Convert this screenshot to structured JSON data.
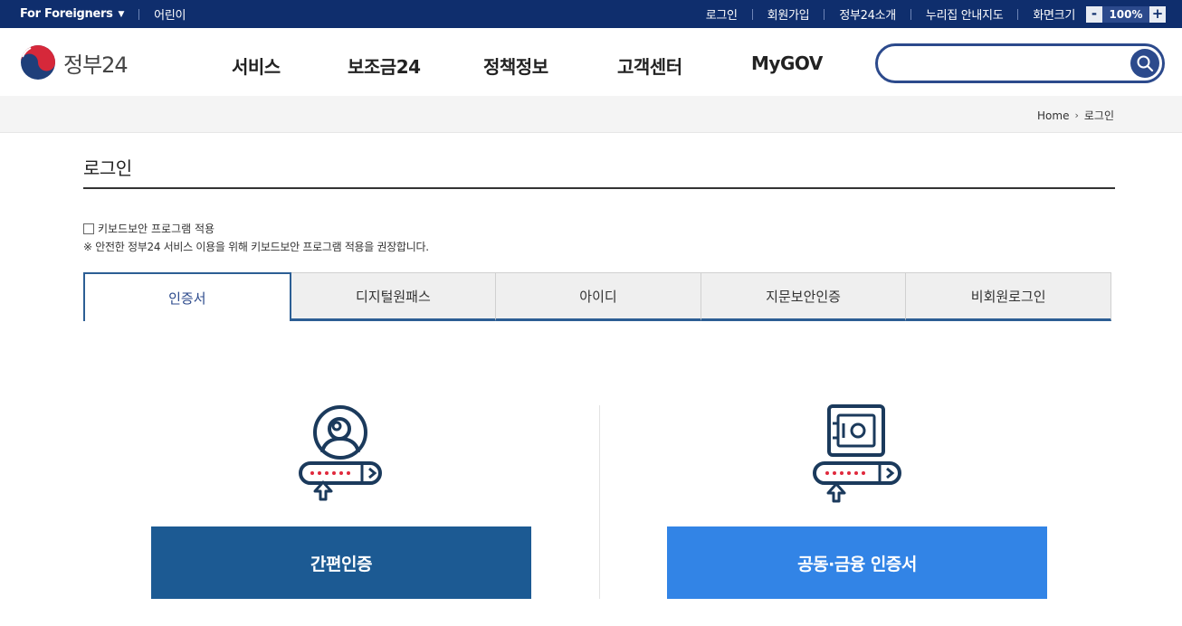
{
  "topbar": {
    "lang_label": "For Foreigners",
    "kids_label": "어린이",
    "links": [
      "로그인",
      "회원가입",
      "정부24소개",
      "누리집 안내지도"
    ],
    "zoom_label": "화면크기",
    "zoom_minus": "-",
    "zoom_value": "100%",
    "zoom_plus": "+"
  },
  "header": {
    "logo_text": "정부24",
    "nav": [
      "서비스",
      "보조금24",
      "정책정보",
      "고객센터",
      "MyGOV"
    ],
    "search_placeholder": ""
  },
  "breadcrumb": {
    "home": "Home",
    "current": "로그인"
  },
  "main": {
    "title": "로그인",
    "keyboard_security_label": "키보드보안 프로그램 적용",
    "keyboard_security_note": "※ 안전한 정부24 서비스 이용을 위해 키보드보안 프로그램 적용을 권장합니다.",
    "tabs": [
      "인증서",
      "디지털원패스",
      "아이디",
      "지문보안인증",
      "비회원로그인"
    ],
    "active_tab": "인증서",
    "simple_auth_button": "간편인증",
    "joint_cert_button": "공동·금융 인증서"
  },
  "colors": {
    "topbar_bg": "#0f2e6d",
    "accent_dark": "#1c5a93",
    "accent_light": "#3284e6",
    "icon_navy": "#1b3a5c",
    "icon_red": "#e0283c"
  }
}
